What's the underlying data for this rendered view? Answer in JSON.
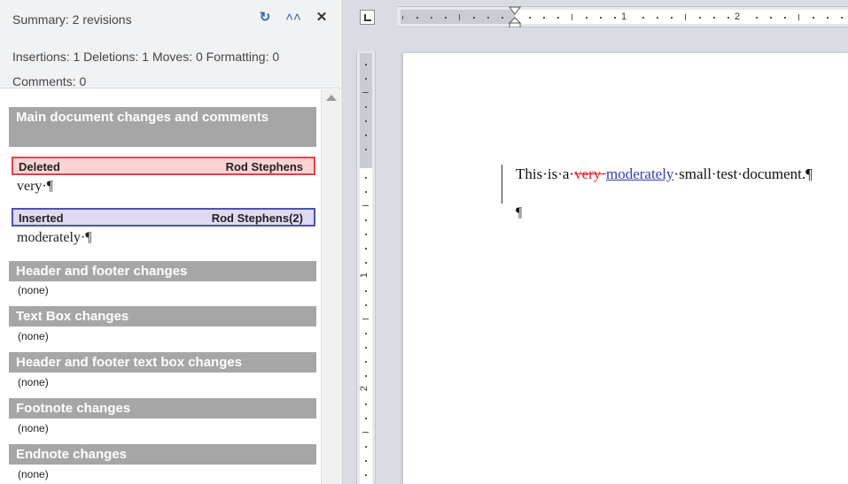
{
  "pane": {
    "title": "Summary: 2 revisions",
    "icons": [
      "refresh-icon",
      "collapse-icon",
      "close-icon"
    ],
    "stats_line1": "Insertions: 1  Deletions: 1  Moves: 0  Formatting: 0",
    "stats_line2": "Comments: 0"
  },
  "sections": {
    "main": "Main document changes and comments",
    "header_footer": "Header and footer changes",
    "text_box": "Text Box changes",
    "header_footer_textbox": "Header and footer text box changes",
    "footnote": "Footnote changes",
    "endnote": "Endnote changes",
    "none_label": "(none)"
  },
  "revisions": [
    {
      "type": "Deleted",
      "author": "Rod Stephens",
      "text": "very·¶",
      "color": "#e0424a"
    },
    {
      "type": "Inserted",
      "author": "Rod Stephens(2)",
      "text": "moderately·¶",
      "color": "#4b54a8"
    }
  ],
  "ruler": {
    "h_numbers": [
      "1",
      "2"
    ],
    "v_numbers": [
      "1",
      "2"
    ]
  },
  "document": {
    "before": "This·is·a·",
    "deleted": "very·",
    "inserted": "moderately",
    "after": "·small·test·document.¶",
    "para_mark": "¶",
    "deleted_color": "#e0242b",
    "inserted_color": "#2e3fb0"
  }
}
